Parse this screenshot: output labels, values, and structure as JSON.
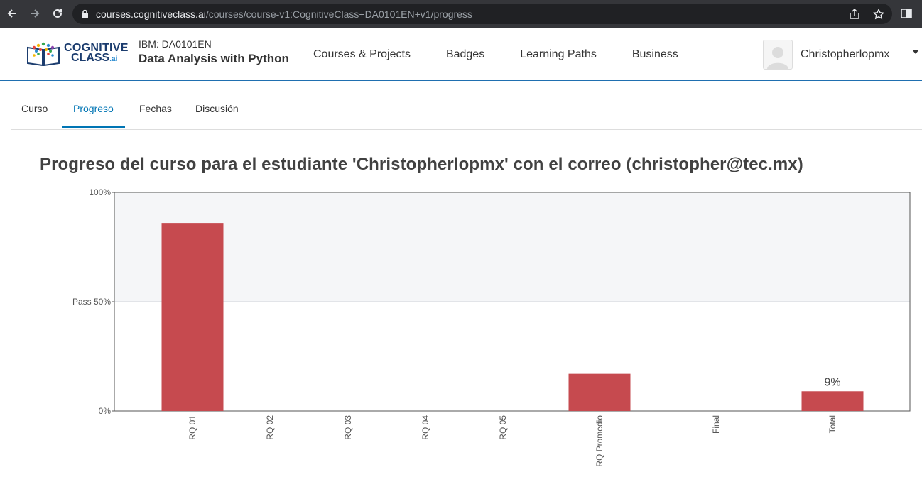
{
  "browser": {
    "url_host": "courses.cognitiveclass.ai",
    "url_path": "/courses/course-v1:CognitiveClass+DA0101EN+v1/progress"
  },
  "header": {
    "logo_line1": "COGNITIVE",
    "logo_line2": "CLASS",
    "logo_suffix": ".ai",
    "course_code": "IBM: DA0101EN",
    "course_name": "Data Analysis with Python",
    "nav": [
      "Courses & Projects",
      "Badges",
      "Learning Paths",
      "Business"
    ],
    "username": "Christopherlopmx"
  },
  "tabs": {
    "items": [
      "Curso",
      "Progreso",
      "Fechas",
      "Discusión"
    ],
    "active": "Progreso"
  },
  "page": {
    "title": "Progreso del curso para el estudiante 'Christopherlopmx' con el correo (christopher@tec.mx)"
  },
  "colors": {
    "bar": "#c64a4f",
    "pass_region": "#f5f6f8",
    "accent": "#0075b4"
  },
  "chart_data": {
    "type": "bar",
    "categories": [
      "RQ 01",
      "RQ 02",
      "RQ 03",
      "RQ 04",
      "RQ 05",
      "RQ Promedio",
      "Final",
      "Total"
    ],
    "values": [
      86,
      0,
      0,
      0,
      0,
      17,
      0,
      9
    ],
    "ylim": [
      0,
      100
    ],
    "y_ticks": [
      {
        "value": 100,
        "label": "100%"
      },
      {
        "value": 50,
        "label": "Pass 50%"
      },
      {
        "value": 0,
        "label": "0%"
      }
    ],
    "data_labels": [
      {
        "category": "Total",
        "label": "9%"
      }
    ],
    "shaded_above": 50,
    "grid": false
  }
}
